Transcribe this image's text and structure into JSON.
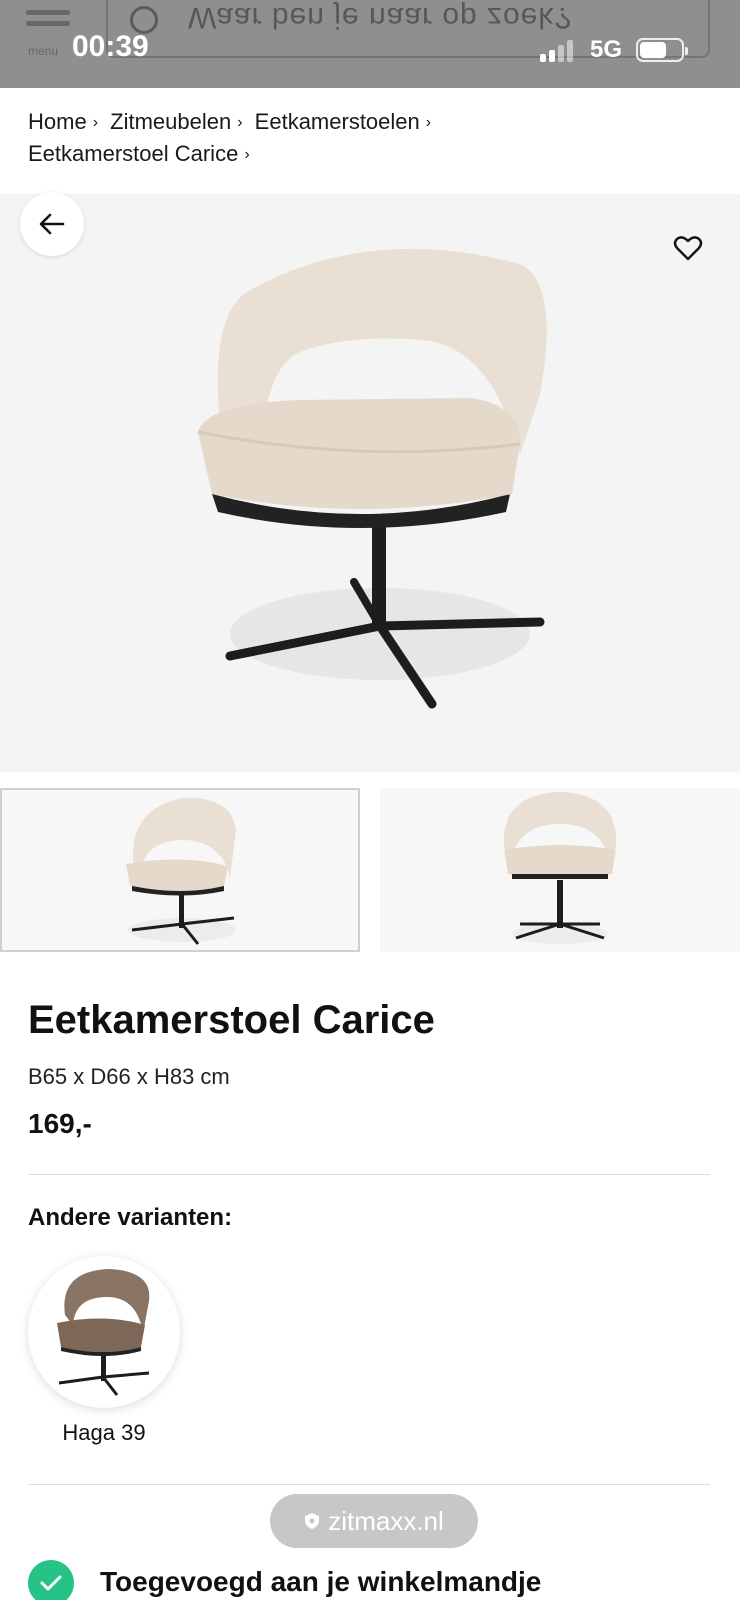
{
  "status_bar": {
    "time": "00:39",
    "network": "5G"
  },
  "header": {
    "menu_label": "menu",
    "search_placeholder": "Waar ben je naar op zoek?"
  },
  "breadcrumb": {
    "items": [
      "Home",
      "Zitmeubelen",
      "Eetkamerstoelen",
      "Eetkamerstoel Carice"
    ],
    "separator": "›"
  },
  "product": {
    "title": "Eetkamerstoel Carice",
    "dimensions": "B65 x D66 x H83 cm",
    "price": "169,-",
    "fabric_color": "#e9dfd2",
    "base_color": "#1d1d1d"
  },
  "variants": {
    "title": "Andere varianten:",
    "items": [
      {
        "name": "Haga 39",
        "fabric_color": "#8a7463"
      }
    ]
  },
  "site_pill": {
    "domain": "zitmaxx.nl"
  },
  "toast": {
    "message": "Toegevoegd aan je winkelmandje",
    "accent": "#27c286"
  },
  "icons": {
    "back": "arrow-left-icon",
    "favorite": "heart-icon",
    "check": "check-icon"
  }
}
